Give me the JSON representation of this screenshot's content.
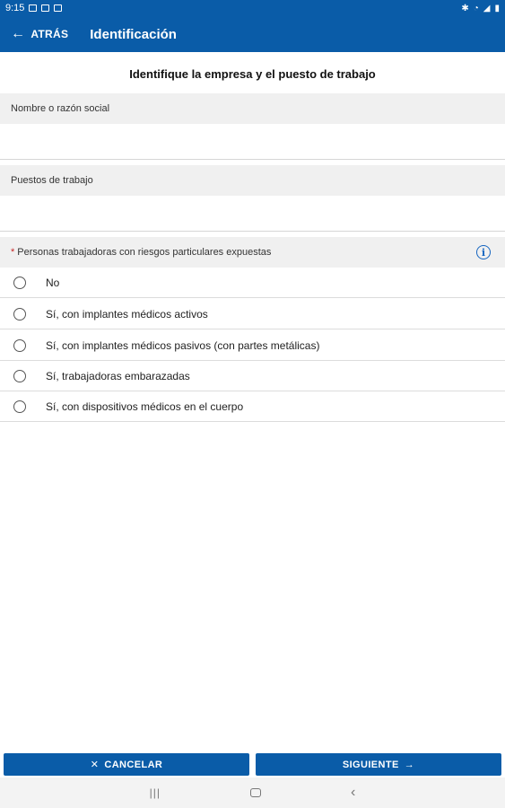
{
  "status_bar": {
    "time": "9:15",
    "battery": "⚡ 🔋"
  },
  "app_bar": {
    "back_label": "ATRÁS",
    "title": "Identificación"
  },
  "page": {
    "heading": "Identifique la empresa y el puesto de trabajo"
  },
  "fields": {
    "company": {
      "label": "Nombre o razón social",
      "value": "",
      "placeholder": ""
    },
    "positions": {
      "label": "Puestos de trabajo",
      "value": "",
      "placeholder": ""
    }
  },
  "risk_section": {
    "required_mark": "*",
    "label": "Personas trabajadoras con riesgos particulares expuestas",
    "info_icon": "info-icon",
    "options": [
      {
        "label": "No",
        "selected": false
      },
      {
        "label": "Sí, con implantes médicos activos",
        "selected": false
      },
      {
        "label": "Sí, con implantes médicos pasivos (con partes metálicas)",
        "selected": false
      },
      {
        "label": "Sí, trabajadoras embarazadas",
        "selected": false
      },
      {
        "label": "Sí, con dispositivos médicos en el cuerpo",
        "selected": false
      }
    ]
  },
  "footer": {
    "cancel_label": "CANCELAR",
    "next_label": "SIGUIENTE"
  },
  "colors": {
    "primary": "#0a5ca8",
    "section_bg": "#f0f0f0",
    "info": "#1565c0",
    "required": "#c62828"
  }
}
